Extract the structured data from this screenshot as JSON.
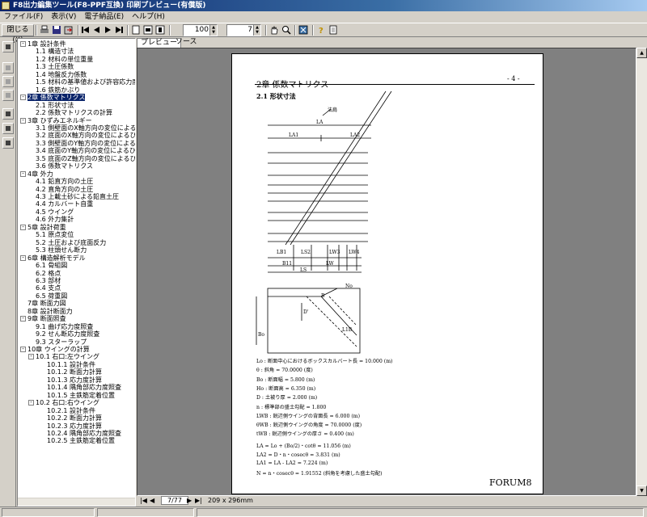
{
  "window": {
    "title": "F8出力編集ツール(F8-PPF互換) 印刷プレビュー(有償版)"
  },
  "menu": [
    "ファイル(F)",
    "表示(V)",
    "電子納品(E)",
    "ヘルプ(H)"
  ],
  "toolbar": {
    "close_label": "閉じる(X)",
    "zoom_value": "100",
    "page_value": "7"
  },
  "tabs": [
    "プレビュー",
    "ソース"
  ],
  "tree": [
    {
      "label": "1章 設計条件",
      "level": 0,
      "expander": "-"
    },
    {
      "label": "1.1 構造寸法",
      "level": 1
    },
    {
      "label": "1.2 材料の単位重量",
      "level": 1
    },
    {
      "label": "1.3 土圧係数",
      "level": 1
    },
    {
      "label": "1.4 地盤反力係数",
      "level": 1
    },
    {
      "label": "1.5 材料の基準値および許容応力度",
      "level": 1
    },
    {
      "label": "1.6 鉄筋かぶり",
      "level": 1
    },
    {
      "label": "2章 係数マトリクス",
      "level": 0,
      "expander": "-",
      "selected": true
    },
    {
      "label": "2.1 形状寸法",
      "level": 1
    },
    {
      "label": "2.2 係数マトリクスの計算",
      "level": 1
    },
    {
      "label": "3章 ひずみエネルギー",
      "level": 0,
      "expander": "-"
    },
    {
      "label": "3.1 側壁面のX軸方向の変位によるひず",
      "level": 1
    },
    {
      "label": "3.2 底面のX軸方向の変位によるひずみ",
      "level": 1
    },
    {
      "label": "3.3 側壁面のY軸方向の変位によるひず",
      "level": 1
    },
    {
      "label": "3.4 底面のY軸方向の変位によるひずみ",
      "level": 1
    },
    {
      "label": "3.5 底面のZ軸方向の変位によるひずみ",
      "level": 1
    },
    {
      "label": "3.6 係数マトリクス",
      "level": 1
    },
    {
      "label": "4章 外力",
      "level": 0,
      "expander": "-"
    },
    {
      "label": "4.1 鉛直方向の土圧",
      "level": 1
    },
    {
      "label": "4.2 直角方向の土圧",
      "level": 1
    },
    {
      "label": "4.3 上載土砂による鉛直土圧",
      "level": 1
    },
    {
      "label": "4.4 カルバート自重",
      "level": 1
    },
    {
      "label": "4.5 ウイング",
      "level": 1
    },
    {
      "label": "4.6 外力集計",
      "level": 1
    },
    {
      "label": "5章 設計荷重",
      "level": 0,
      "expander": "-"
    },
    {
      "label": "5.1 原点変位",
      "level": 1
    },
    {
      "label": "5.2 土圧および底面反力",
      "level": 1
    },
    {
      "label": "5.3 柱頭せん断力",
      "level": 1
    },
    {
      "label": "6章 構造解析モデル",
      "level": 0,
      "expander": "-"
    },
    {
      "label": "6.1 骨組図",
      "level": 1
    },
    {
      "label": "6.2 格点",
      "level": 1
    },
    {
      "label": "6.3 部材",
      "level": 1
    },
    {
      "label": "6.4 支点",
      "level": 1
    },
    {
      "label": "6.5 荷重図",
      "level": 1
    },
    {
      "label": "7章 断面力図",
      "level": 0
    },
    {
      "label": "8章 設計断面力",
      "level": 0
    },
    {
      "label": "9章 断面照査",
      "level": 0,
      "expander": "-"
    },
    {
      "label": "9.1 曲げ応力度照査",
      "level": 1
    },
    {
      "label": "9.2 せん断応力度照査",
      "level": 1
    },
    {
      "label": "9.3 スターラップ",
      "level": 1
    },
    {
      "label": "10章 ウイングの計算",
      "level": 0,
      "expander": "-"
    },
    {
      "label": "10.1 右口:左ウイング",
      "level": 1,
      "expander": "-"
    },
    {
      "label": "10.1.1 設計条件",
      "level": 2
    },
    {
      "label": "10.1.2 断面力計算",
      "level": 2
    },
    {
      "label": "10.1.3 応力度計算",
      "level": 2
    },
    {
      "label": "10.1.4 隅角部応力度照査",
      "level": 2
    },
    {
      "label": "10.1.5 主鉄筋定着位置",
      "level": 2
    },
    {
      "label": "10.2 右口:右ウイング",
      "level": 1,
      "expander": "-"
    },
    {
      "label": "10.2.1 設計条件",
      "level": 2
    },
    {
      "label": "10.2.2 断面力計算",
      "level": 2
    },
    {
      "label": "10.2.3 応力度計算",
      "level": 2
    },
    {
      "label": "10.2.4 隅角部応力度照査",
      "level": 2
    },
    {
      "label": "10.2.5 主鉄筋定着位置",
      "level": 2
    }
  ],
  "document": {
    "page_marker": "- 4 -",
    "chapter": "2章 係数マトリクス",
    "section": "2.1 形状寸法",
    "footer_brand": "FORUM8",
    "dim_labels": {
      "houyo": "法肩",
      "la": "LA",
      "la1": "LA1",
      "la2": "LA2",
      "lb1": "LB1",
      "ls2": "LS2",
      "lw3": "LW3",
      "lw4": "LW4",
      "b11": "B11",
      "lw": "LW",
      "ls": "LS",
      "no": "No",
      "b": "B",
      "d": "D'",
      "bo": "Bo",
      "n": "n",
      "l1b": "L1B"
    },
    "definitions": [
      "Lo  : 断面中心におけるボックスカルバート長 = 10.000 (m)",
      "θ  : 斜角         = 70.0000 (度)",
      "Bo  : 断面幅       = 5.800 (m)",
      "Ho  : 断面高       = 6.350 (m)",
      "D   : 土被り厚     = 2.000 (m)",
      "n   : 標準部の盛土勾配 = 1.800",
      "LWB : 鋭辺側ウイングの背面長 = 6.000 (m)",
      "θWB : 鋭辺側ウイングの角度  = 70.0000 (度)",
      "tWB : 鋭辺側ウイングの厚さ  = 0.400 (m)"
    ],
    "formulas": [
      "LA = Lo + (Bo/2)・cotθ = 11.056 (m)",
      "LA2 = D・n・cosecθ  = 3.831 (m)",
      "LA1 = LA - LA2  = 7.224 (m)",
      "N   = n・cosecθ = 1.91552 (斜角を考慮した盛土勾配)"
    ]
  },
  "status": {
    "page": "7/77",
    "paper": "209 x 296mm"
  }
}
